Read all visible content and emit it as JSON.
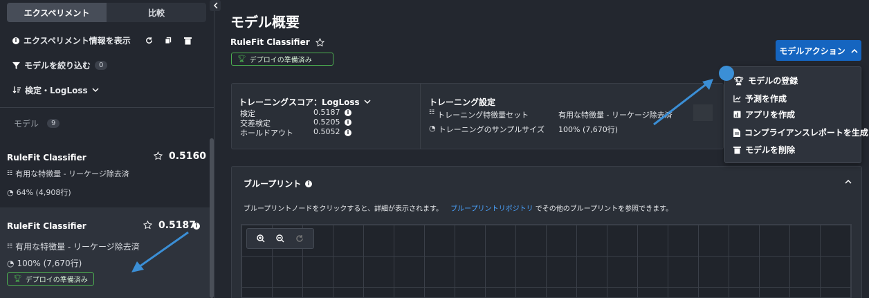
{
  "sidebar": {
    "tabs": [
      {
        "label": "エクスペリメント"
      },
      {
        "label": "比較"
      }
    ],
    "show_info_label": "エクスペリメント情報を表示",
    "filter_label": "モデルを絞り込む",
    "filter_count": "0",
    "sort_label": "検定・LogLoss",
    "models_label": "モデル",
    "models_count": "9",
    "models": [
      {
        "name": "RuleFit Classifier",
        "score": "0.5160",
        "features": "有用な特徴量 - リーケージ除去済",
        "sample": "64% (4,908行)"
      },
      {
        "name": "RuleFit Classifier",
        "score": "0.5187",
        "features": "有用な特徴量 - リーケージ除去済",
        "sample": "100% (7,670行)",
        "badge": "デプロイの準備済み"
      }
    ]
  },
  "main": {
    "title": "モデル概要",
    "model_name": "RuleFit Classifier",
    "deploy_badge": "デプロイの準備済み",
    "action_button": "モデルアクション",
    "score_panel": {
      "title": "トレーニングスコア：LogLoss",
      "rows": [
        {
          "label": "検定",
          "value": "0.5187"
        },
        {
          "label": "交差検定",
          "value": "0.5205"
        },
        {
          "label": "ホールドアウト",
          "value": "0.5052"
        }
      ]
    },
    "settings_panel": {
      "title": "トレーニング設定",
      "rows": [
        {
          "label": "トレーニング特徴量セット",
          "value": "有用な特徴量 - リーケージ除去済"
        },
        {
          "label": "トレーニングのサンプルサイズ",
          "value": "100% (7,670行)"
        }
      ]
    },
    "blueprint": {
      "title": "ブループリント",
      "desc_before": "ブループリントノードをクリックすると、詳細が表示されます。",
      "link": "ブループリントリポジトリ",
      "desc_after": "でその他のブループリントを参照できます。"
    },
    "menu": [
      {
        "label": "モデルの登録",
        "icon": "trophy-icon"
      },
      {
        "label": "予測を作成",
        "icon": "chart-icon"
      },
      {
        "label": "アプリを作成",
        "icon": "app-icon"
      },
      {
        "label": "コンプライアンスレポートを生成",
        "icon": "document-icon"
      },
      {
        "label": "モデルを削除",
        "icon": "trash-icon"
      }
    ]
  },
  "colors": {
    "accent": "#1565c0",
    "badge": "#4caf50",
    "annotation": "#3b8fd6"
  }
}
